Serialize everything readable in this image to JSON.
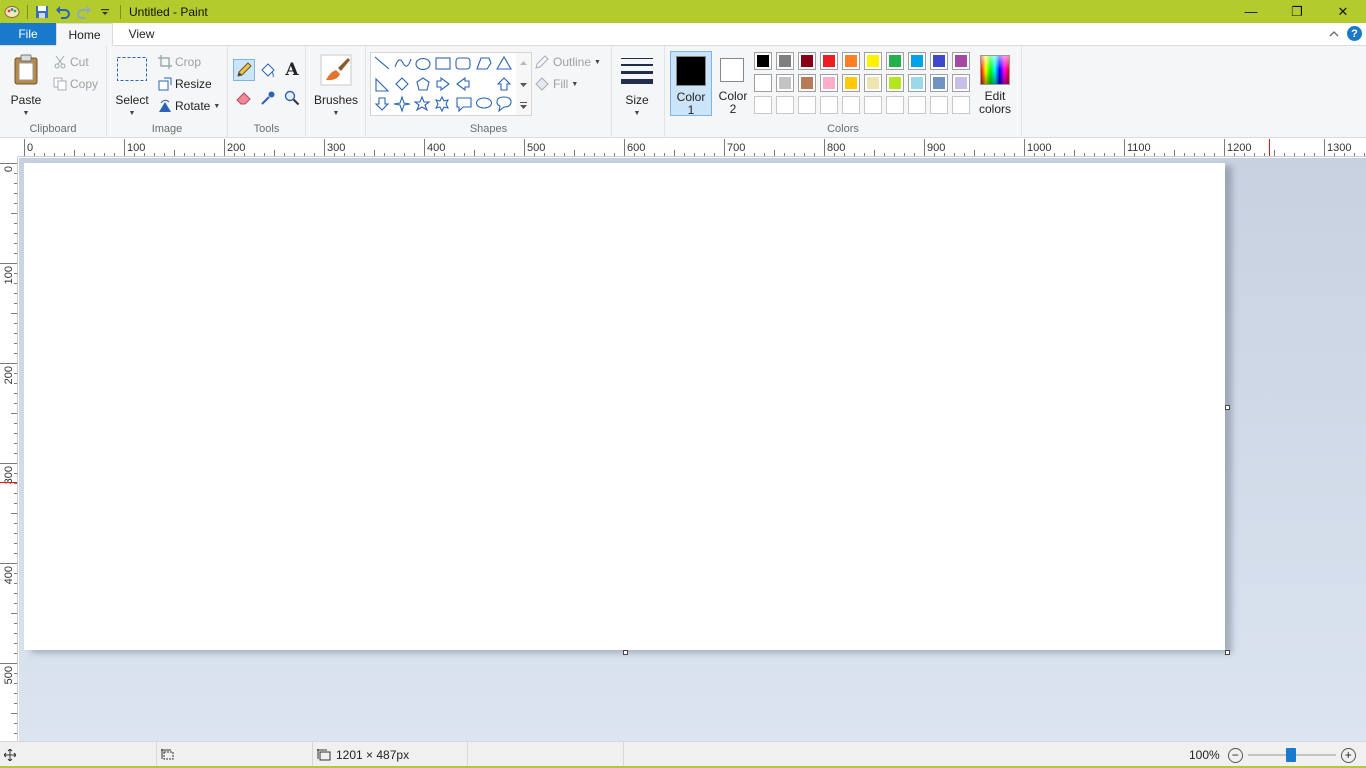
{
  "window": {
    "title": "Untitled - Paint",
    "minimize_symbol": "—",
    "restore_symbol": "❐",
    "close_symbol": "✕",
    "title_color": "#b4cb2d"
  },
  "tabs": {
    "file": "File",
    "home": "Home",
    "view": "View",
    "help_symbol": "?"
  },
  "ribbon": {
    "clipboard": {
      "label": "Clipboard",
      "paste": "Paste",
      "cut": "Cut",
      "copy": "Copy"
    },
    "image": {
      "label": "Image",
      "select": "Select",
      "crop": "Crop",
      "resize": "Resize",
      "rotate": "Rotate"
    },
    "tools": {
      "label": "Tools",
      "text_glyph": "A"
    },
    "brushes": {
      "label": "Brushes"
    },
    "shapes": {
      "label": "Shapes",
      "outline": "Outline",
      "fill": "Fill"
    },
    "size": {
      "label": "Size"
    },
    "colors": {
      "label": "Colors",
      "color1_line1": "Color",
      "color1_line2": "1",
      "color2_line1": "Color",
      "color2_line2": "2",
      "edit_line1": "Edit",
      "edit_line2": "colors",
      "color1_value": "#000000",
      "color2_value": "#ffffff",
      "palette_row1": [
        "#000000",
        "#7f7f7f",
        "#880015",
        "#ed1c24",
        "#ff7f27",
        "#fff200",
        "#22b14c",
        "#00a2e8",
        "#3f48cc",
        "#a349a4"
      ],
      "palette_row2": [
        "#ffffff",
        "#c3c3c3",
        "#b97a57",
        "#ffaec9",
        "#ffc90e",
        "#efe4b0",
        "#b5e61d",
        "#99d9ea",
        "#7092be",
        "#c8bfe7"
      ],
      "palette_row3": [
        "",
        "",
        "",
        "",
        "",
        "",
        "",
        "",
        "",
        ""
      ]
    }
  },
  "rulers": {
    "top_labels": [
      "0",
      "100",
      "200",
      "300",
      "400",
      "500",
      "600",
      "700",
      "800",
      "900",
      "1000",
      "1100",
      "1200",
      "1300"
    ],
    "left_labels": [
      "0",
      "100",
      "200",
      "300",
      "400",
      "500"
    ]
  },
  "statusbar": {
    "canvas_size": "1201 × 487px",
    "zoom": "100%",
    "zoom_level": 1.0
  }
}
